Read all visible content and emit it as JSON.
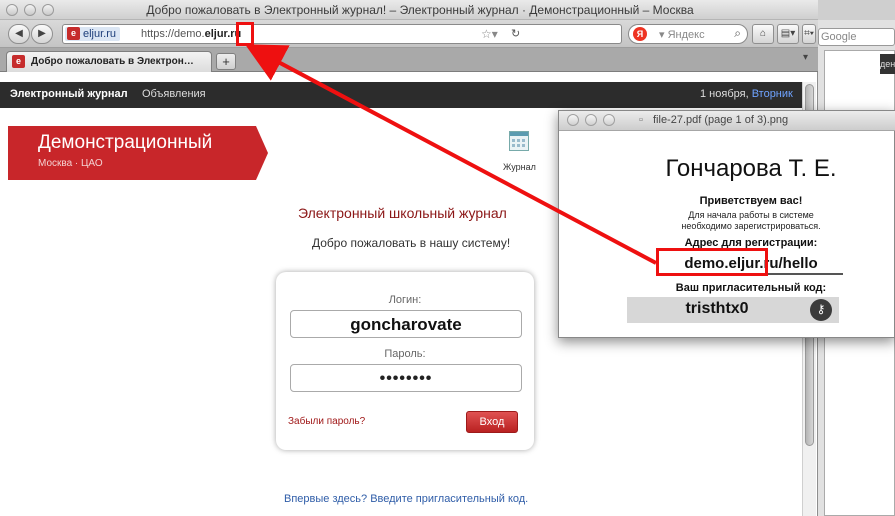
{
  "window": {
    "title": "Добро пожаловать в Электронный журнал! – Электронный журнал · Демонстрационный – Москва"
  },
  "toolbar": {
    "back_glyph": "◀",
    "forward_glyph": "▶",
    "site_badge": "eljur.ru",
    "url_prefix": "https://demo.",
    "url_host": "eljur.ru",
    "search_placeholder": "▾ Яндекс",
    "home_glyph": "⌂",
    "bookmarks_glyph": "▤▾",
    "tools_glyph": "⌗▾"
  },
  "tabs": [
    {
      "label": "Добро пожаловать в Электрон…",
      "active": true
    }
  ],
  "newtab_label": "+",
  "site_nav": {
    "brand": "Электронный журнал",
    "announcements": "Объявления",
    "date": "1 ноября, ",
    "day": "Вторник"
  },
  "banner": {
    "title": "Демонстрационный",
    "subtitle": "Москва · ЦАО"
  },
  "journal_link": {
    "label": "Журнал"
  },
  "main": {
    "heading": "Электронный школьный журнал",
    "welcome": "Добро пожаловать в нашу систему!",
    "first_time": "Впервые здесь? Введите пригласительный код."
  },
  "login": {
    "login_label": "Логин:",
    "login_value": "goncharovate",
    "password_label": "Пароль:",
    "password_value": "••••••••",
    "forgot": "Забыли пароль?",
    "submit": "Вход"
  },
  "right_window": {
    "search_text": "Google",
    "tab_snippet": "ден"
  },
  "preview": {
    "title": "file-27.pdf (page 1 of 3).png",
    "name": "Гончарова Т. Е.",
    "greeting": "Приветствуем вас!",
    "start_line1": "Для начала работы в системе",
    "start_line2": "необходимо зарегистрироваться.",
    "address_label": "Адрес для регистрации:",
    "address": "demo.eljur.ru/hello",
    "code_label": "Ваш пригласительный код:",
    "code": "tristhtx0"
  },
  "colors": {
    "accent_red": "#c8262a",
    "highlight": "#ee1010",
    "nav_dark": "#2c2c2c",
    "link_blue": "#2f5da8"
  }
}
